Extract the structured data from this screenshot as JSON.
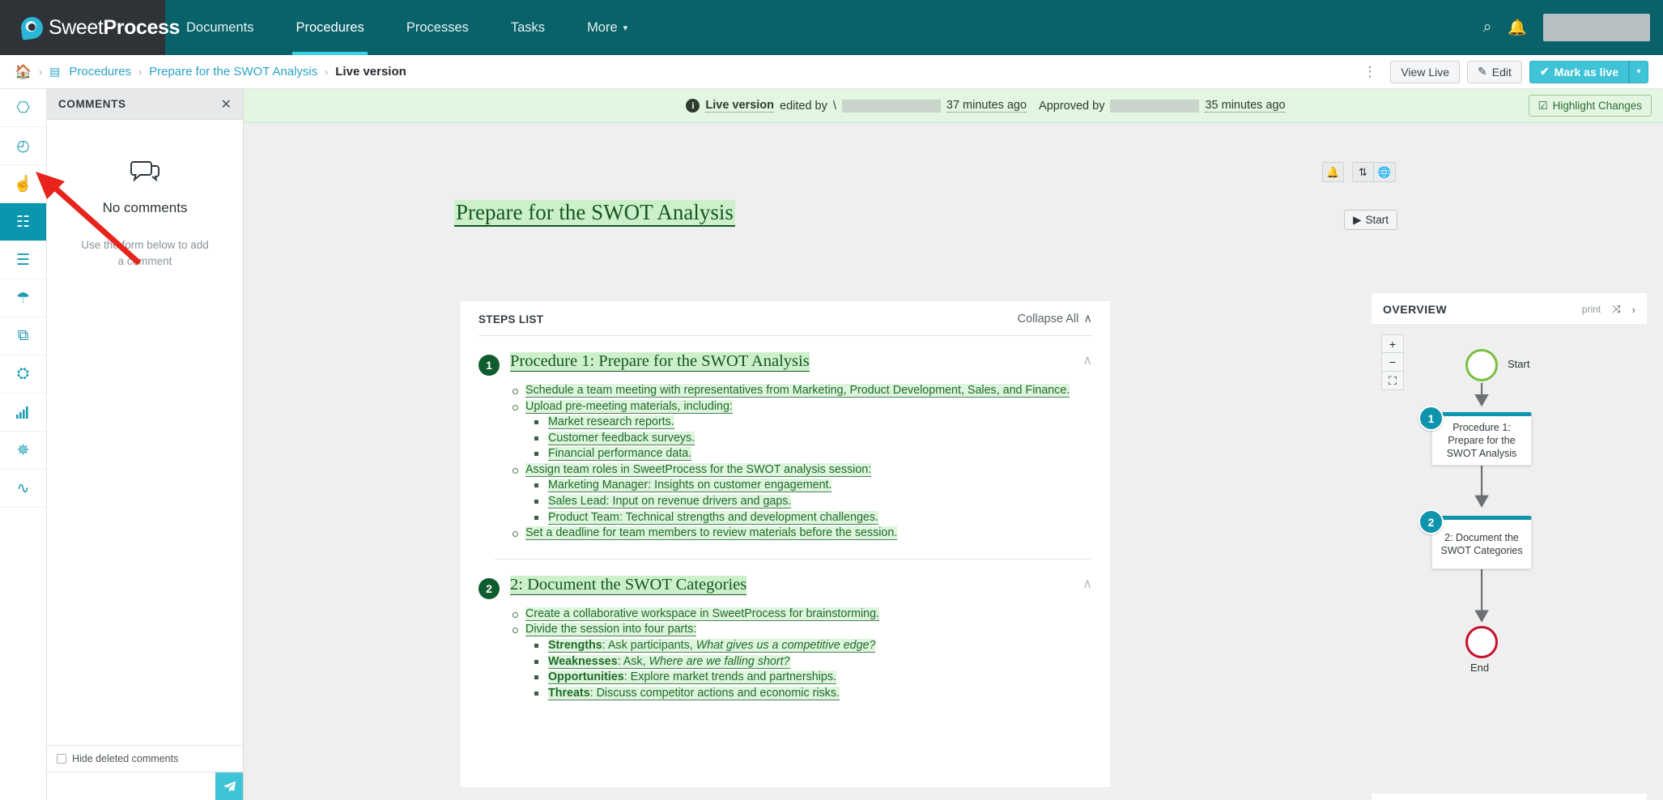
{
  "topnav": {
    "brand_thin": "Sweet",
    "brand_bold": "Process",
    "items": [
      {
        "label": "Documents",
        "active": false
      },
      {
        "label": "Procedures",
        "active": true
      },
      {
        "label": "Processes",
        "active": false
      },
      {
        "label": "Tasks",
        "active": false
      },
      {
        "label": "More",
        "active": false,
        "caret": "▾"
      }
    ],
    "search_icon": "⌕",
    "bell_icon": "🔔"
  },
  "breadcrumb": {
    "home_icon": "🏠",
    "doc_icon": "▤",
    "sep": "›",
    "items": [
      {
        "label": "Procedures",
        "current": false
      },
      {
        "label": "Prepare for the SWOT Analysis",
        "current": false
      },
      {
        "label": "Live version",
        "current": true
      }
    ],
    "kebab": "⋮",
    "view_live_label": "View Live",
    "edit_label": "Edit",
    "edit_icon": "✎",
    "mark_as_live_label": "Mark as live",
    "mark_check": "✔",
    "mark_caret": "▾"
  },
  "rail": {
    "items": [
      {
        "icon": "⎔",
        "name": "document-icon",
        "active": false
      },
      {
        "icon": "◴",
        "name": "history-clock-icon",
        "active": false
      },
      {
        "icon": "☝",
        "name": "thumbs-up-icon",
        "active": false
      },
      {
        "icon": "☷",
        "name": "comments-icon",
        "active": true
      },
      {
        "icon": "☰",
        "name": "checklist-icon",
        "active": false
      },
      {
        "icon": "☂",
        "name": "umbrella-icon",
        "active": false
      },
      {
        "icon": "⧉",
        "name": "duplicate-icon",
        "active": false
      },
      {
        "icon": "⛭",
        "name": "teams-icon",
        "active": false
      },
      {
        "icon": "▂",
        "name": "bar-chart-icon",
        "active": false
      },
      {
        "icon": "✵",
        "name": "gear-icon",
        "active": false
      },
      {
        "icon": "∿",
        "name": "signature-icon",
        "active": false
      }
    ]
  },
  "comments": {
    "title": "COMMENTS",
    "close_icon": "✕",
    "bubble_icon": "💬",
    "empty_title": "No comments",
    "empty_hint": "Use the form below to add a comment",
    "hide_deleted_label": "Hide deleted comments",
    "input_placeholder": "",
    "input_value": "",
    "send_icon": "➤"
  },
  "notice": {
    "info_icon": "i",
    "live_version": "Live version",
    "edited_by": "edited by",
    "editor_prefix": "\\",
    "edited_time": "37 minutes ago",
    "approved_by": "Approved by",
    "approved_time": "35 minutes ago",
    "highlight_changes_label": "Highlight Changes",
    "highlight_icon": "☑"
  },
  "document": {
    "title": "Prepare for the SWOT Analysis",
    "toolbar_icons": [
      {
        "glyph": "🔔",
        "name": "notification-bell-icon"
      },
      {
        "glyph": "⇅",
        "name": "sort-icon"
      },
      {
        "glyph": "🌐",
        "name": "globe-icon"
      }
    ],
    "start_label": "Start",
    "start_icon": "▶",
    "steps_list_label": "STEPS LIST",
    "collapse_all_label": "Collapse All",
    "collapse_caret": "∧",
    "chevron": "∧",
    "steps": [
      {
        "number": "1",
        "title": "Procedure 1: Prepare for the SWOT Analysis",
        "items": [
          {
            "text": "Schedule a team meeting with representatives from Marketing, Product Development, Sales, and Finance.",
            "children": []
          },
          {
            "text": "Upload pre-meeting materials, including:",
            "children": [
              {
                "text": "Market research reports."
              },
              {
                "text": "Customer feedback surveys."
              },
              {
                "text": "Financial performance data."
              }
            ]
          },
          {
            "text": "Assign team roles in SweetProcess for the SWOT analysis session:",
            "children": [
              {
                "text": "Marketing Manager: Insights on customer engagement."
              },
              {
                "text": "Sales Lead: Input on revenue drivers and gaps."
              },
              {
                "text": "Product Team: Technical strengths and development challenges."
              }
            ]
          },
          {
            "text": "Set a deadline for team members to review materials before the session.",
            "children": []
          }
        ]
      },
      {
        "number": "2",
        "title": "2: Document the SWOT Categories",
        "items": [
          {
            "text": "Create a collaborative workspace in SweetProcess for brainstorming.",
            "children": []
          },
          {
            "text": "Divide the session into four parts:",
            "children": [
              {
                "bold": "Strengths",
                "text": ": Ask participants, ",
                "italic": "What gives us a competitive edge?"
              },
              {
                "bold": "Weaknesses",
                "text": ": Ask, ",
                "italic": "Where are we falling short?"
              },
              {
                "bold": "Opportunities",
                "text": ": Explore market trends and partnerships.",
                "italic": ""
              },
              {
                "bold": "Threats",
                "text": ": Discuss competitor actions and economic risks.",
                "italic": ""
              }
            ]
          }
        ]
      }
    ]
  },
  "overview": {
    "title": "OVERVIEW",
    "print_label": "print",
    "expand_icon": "⤨",
    "next_icon": "›",
    "zoom_in": "+",
    "zoom_out": "−",
    "fit_icon": "⛶",
    "nodes": [
      {
        "type": "circle-start",
        "label": "Start"
      },
      {
        "type": "box",
        "badge": "1",
        "label": "Procedure 1: Prepare for the SWOT Analysis"
      },
      {
        "type": "box",
        "badge": "2",
        "label": "2: Document the SWOT Categories"
      },
      {
        "type": "circle-end",
        "label": "End"
      }
    ]
  },
  "colors": {
    "nav_bg": "#096269",
    "brand_bg": "#2f3338",
    "accent": "#3fc3d6",
    "node_teal": "#0e94ad",
    "start_green": "#79bf3f",
    "end_red": "#c8102e",
    "highlight_green": "#ddf4dd",
    "annotation_red": "#e8231c"
  }
}
